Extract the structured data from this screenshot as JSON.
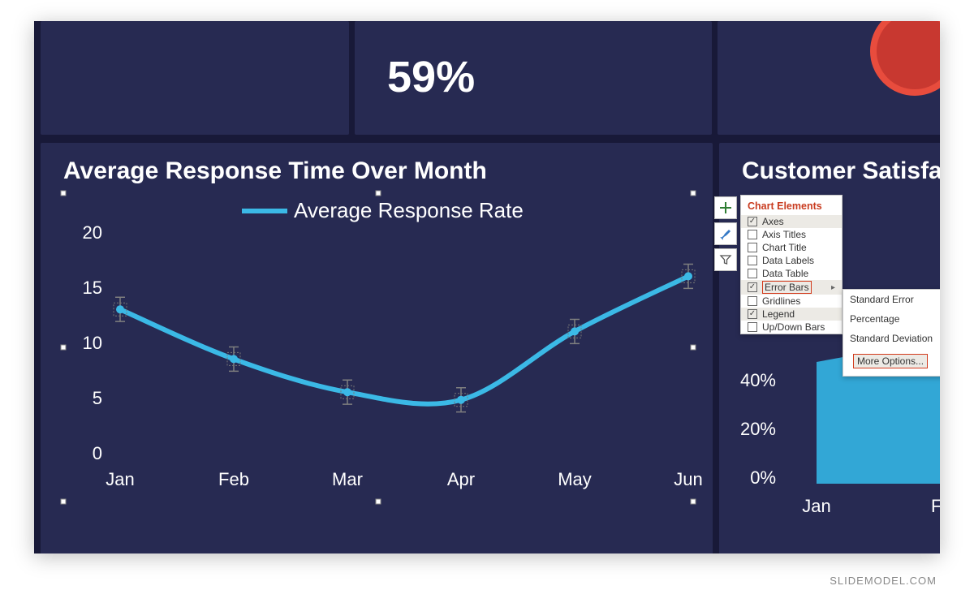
{
  "watermark": "SLIDEMODEL.COM",
  "kpi_value": "59%",
  "main_title": "Average Response Time Over Month",
  "right_title": "Customer Satisfa",
  "legend_label": "Average Response Rate",
  "chart_elements_panel": {
    "title": "Chart Elements",
    "items": [
      {
        "label": "Axes",
        "checked": true
      },
      {
        "label": "Axis Titles",
        "checked": false
      },
      {
        "label": "Chart Title",
        "checked": false
      },
      {
        "label": "Data Labels",
        "checked": false
      },
      {
        "label": "Data Table",
        "checked": false
      },
      {
        "label": "Error Bars",
        "checked": true,
        "highlighted": true,
        "has_submenu": true
      },
      {
        "label": "Gridlines",
        "checked": false
      },
      {
        "label": "Legend",
        "checked": true
      },
      {
        "label": "Up/Down Bars",
        "checked": false
      }
    ],
    "submenu": [
      "Standard Error",
      "Percentage",
      "Standard Deviation",
      "More Options..."
    ]
  },
  "right_y_ticks": [
    "40%",
    "20%",
    "0%"
  ],
  "right_x_ticks": [
    "Jan",
    "Feb"
  ],
  "chart_data": {
    "type": "line",
    "title": "Average Response Time Over Month",
    "series": [
      {
        "name": "Average Response Rate",
        "values": [
          13,
          8.5,
          5.5,
          4.8,
          11,
          16
        ]
      }
    ],
    "categories": [
      "Jan",
      "Feb",
      "Mar",
      "Apr",
      "May",
      "Jun"
    ],
    "y_ticks": [
      0,
      5,
      10,
      15,
      20
    ],
    "x_ticks": [
      "Jan",
      "Feb",
      "Mar",
      "Apr",
      "May",
      "Jun"
    ],
    "ylim": [
      0,
      20
    ],
    "xlabel": "",
    "ylabel": "",
    "error_bars": true,
    "legend_position": "top"
  }
}
